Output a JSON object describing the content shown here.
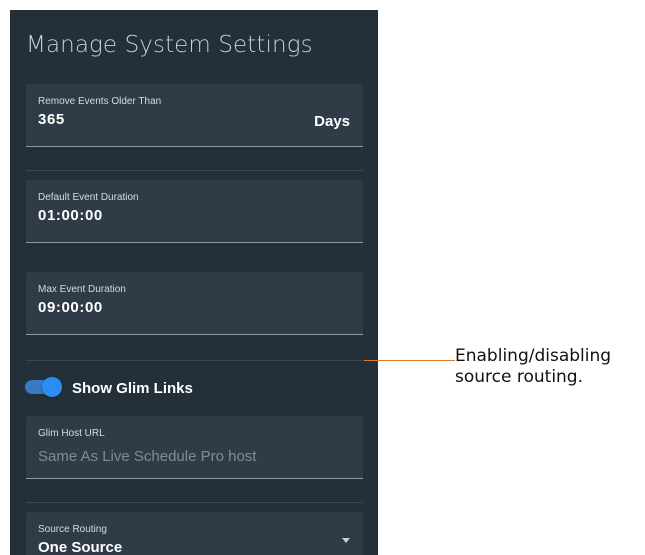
{
  "panel": {
    "title": "Manage System Settings"
  },
  "fields": {
    "remove_events": {
      "label": "Remove Events Older Than",
      "value": "365",
      "suffix": "Days"
    },
    "default_duration": {
      "label": "Default Event Duration",
      "value": "01:00:00"
    },
    "max_duration": {
      "label": "Max Event Duration",
      "value": "09:00:00"
    },
    "glim_host": {
      "label": "Glim Host URL",
      "placeholder": "Same As Live Schedule Pro host"
    },
    "source_routing": {
      "label": "Source Routing",
      "value": "One Source"
    }
  },
  "toggle": {
    "label": "Show Glim Links",
    "on": true
  },
  "callout": {
    "line1": "Enabling/disabling",
    "line2": "source routing."
  },
  "colors": {
    "panel_bg": "#232f39",
    "field_bg": "#2f3c47",
    "toggle_on": "#2b8ef2",
    "callout_line": "#e07b29"
  }
}
